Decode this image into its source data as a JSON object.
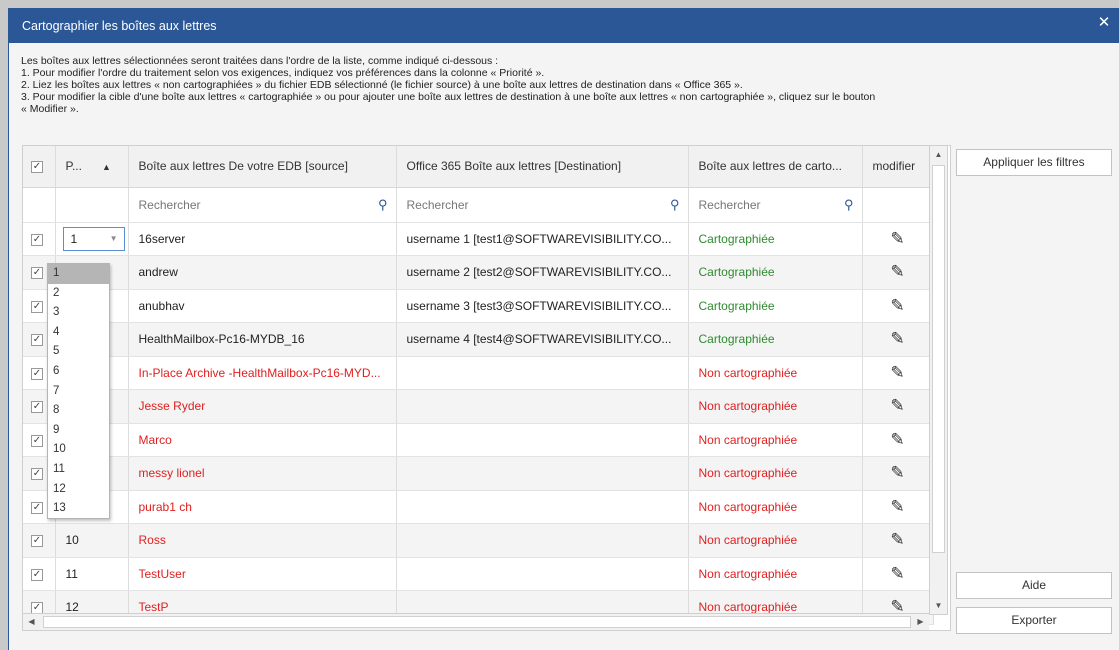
{
  "window": {
    "title": "Cartographier les boîtes aux lettres"
  },
  "instructions": [
    "Les boîtes aux lettres sélectionnées seront traitées dans l'ordre de la liste, comme indiqué ci-dessous :",
    "1. Pour modifier l'ordre du traitement selon vos exigences, indiquez vos préférences dans la colonne « Priorité ».",
    "2. Liez les boîtes aux lettres « non cartographiées » du fichier EDB sélectionné (le fichier source) à une boîte aux lettres de destination dans « Office 365 ».",
    "3. Pour modifier la cible d'une boîte aux lettres « cartographiée » ou pour ajouter une boîte aux lettres de destination à une boîte aux lettres « non cartographiée », cliquez sur le bouton",
    "« Modifier »."
  ],
  "columns": {
    "priority": "P...",
    "source": "Boîte aux lettres De votre EDB [source]",
    "destination": "Office 365 Boîte aux lettres [Destination]",
    "status": "Boîte aux lettres de carto...",
    "edit": "modifier"
  },
  "search_placeholder": "Rechercher",
  "priority_options": [
    "1",
    "2",
    "3",
    "4",
    "5",
    "6",
    "7",
    "8",
    "9",
    "10",
    "11",
    "12",
    "13"
  ],
  "rows": [
    {
      "priority": "1",
      "source": "16server",
      "destination": "username 1 [test1@SOFTWAREVISIBILITY.CO...",
      "status": "Cartographiée"
    },
    {
      "priority": "",
      "source": "andrew",
      "destination": "username 2 [test2@SOFTWAREVISIBILITY.CO...",
      "status": "Cartographiée"
    },
    {
      "priority": "",
      "source": "anubhav",
      "destination": "username 3 [test3@SOFTWAREVISIBILITY.CO...",
      "status": "Cartographiée"
    },
    {
      "priority": "",
      "source": "HealthMailbox-Pc16-MYDB_16",
      "destination": "username 4 [test4@SOFTWAREVISIBILITY.CO...",
      "status": "Cartographiée"
    },
    {
      "priority": "",
      "source": "In-Place Archive -HealthMailbox-Pc16-MYD...",
      "destination": "",
      "status": "Non cartographiée"
    },
    {
      "priority": "",
      "source": "Jesse Ryder",
      "destination": "",
      "status": "Non cartographiée"
    },
    {
      "priority": "",
      "source": "Marco",
      "destination": "",
      "status": "Non cartographiée"
    },
    {
      "priority": "",
      "source": "messy lionel",
      "destination": "",
      "status": "Non cartographiée"
    },
    {
      "priority": "",
      "source": "purab1 ch",
      "destination": "",
      "status": "Non cartographiée"
    },
    {
      "priority": "10",
      "source": "Ross",
      "destination": "",
      "status": "Non cartographiée"
    },
    {
      "priority": "11",
      "source": "TestUser",
      "destination": "",
      "status": "Non cartographiée"
    },
    {
      "priority": "12",
      "source": "TestP",
      "destination": "",
      "status": "Non cartographiée"
    }
  ],
  "buttons": {
    "apply_filters": "Appliquer les filtres",
    "help": "Aide",
    "export": "Exporter"
  },
  "colors": {
    "title_bar": "#2b5797",
    "mapped": "#2e8b2e",
    "unmapped": "#e02020"
  }
}
